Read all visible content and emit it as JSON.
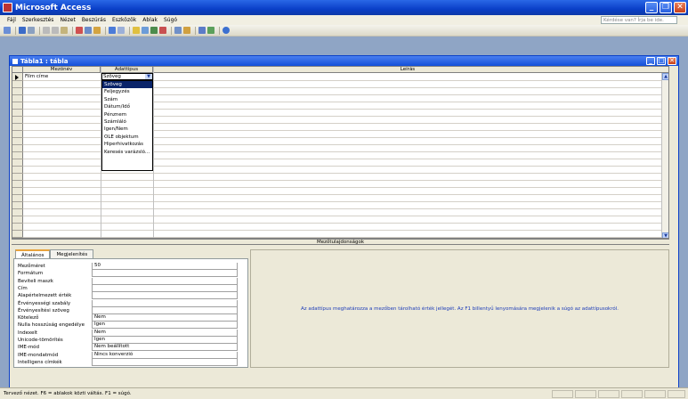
{
  "app": {
    "title": "Microsoft Access"
  },
  "menu": {
    "items": [
      "Fájl",
      "Szerkesztés",
      "Nézet",
      "Beszúrás",
      "Eszközök",
      "Ablak",
      "Súgó"
    ],
    "help_placeholder": "Kérdése van? Írja be ide."
  },
  "window": {
    "title": "Tábla1 : tábla"
  },
  "grid": {
    "headers": {
      "field": "Mezőnév",
      "type": "Adattípus",
      "desc": "Leírás"
    },
    "row1": {
      "field": "Film címe",
      "type": "Szöveg"
    },
    "type_options": [
      "Szöveg",
      "Feljegyzés",
      "Szám",
      "Dátum/Idő",
      "Pénznem",
      "Számláló",
      "Igen/Nem",
      "OLE objektum",
      "Hiperhivatkozás",
      "Keresés varázsló..."
    ],
    "selected_index": 0
  },
  "properties": {
    "title": "Mezőtulajdonságok",
    "tabs": [
      "Általános",
      "Megjelenítés"
    ],
    "rows": [
      {
        "label": "Mezőméret",
        "value": "50"
      },
      {
        "label": "Formátum",
        "value": ""
      },
      {
        "label": "Beviteli maszk",
        "value": ""
      },
      {
        "label": "Cím",
        "value": ""
      },
      {
        "label": "Alapértelmezett érték",
        "value": ""
      },
      {
        "label": "Érvényességi szabály",
        "value": ""
      },
      {
        "label": "Érvényesítési szöveg",
        "value": ""
      },
      {
        "label": "Kötelező",
        "value": "Nem"
      },
      {
        "label": "Nulla hosszúság engedélye",
        "value": "Igen"
      },
      {
        "label": "Indexelt",
        "value": "Nem"
      },
      {
        "label": "Unicode-tömörítés",
        "value": "Igen"
      },
      {
        "label": "IME-mód",
        "value": "Nem beállított"
      },
      {
        "label": "IME-mondatmód",
        "value": "Nincs konverzió"
      },
      {
        "label": "Intelligens címkék",
        "value": ""
      }
    ],
    "help": "Az adattípus meghatározza a mezőben tárolható érték jellegét. Az F1 billentyű lenyomására megjelenik a súgó az adattípusokról."
  },
  "status": {
    "text": "Tervező nézet. F6 = ablakok közti váltás. F1 = súgó."
  },
  "colors": {
    "accent": "#0a3fc8",
    "selection": "#0a246a",
    "help_text": "#1c3cb8"
  }
}
